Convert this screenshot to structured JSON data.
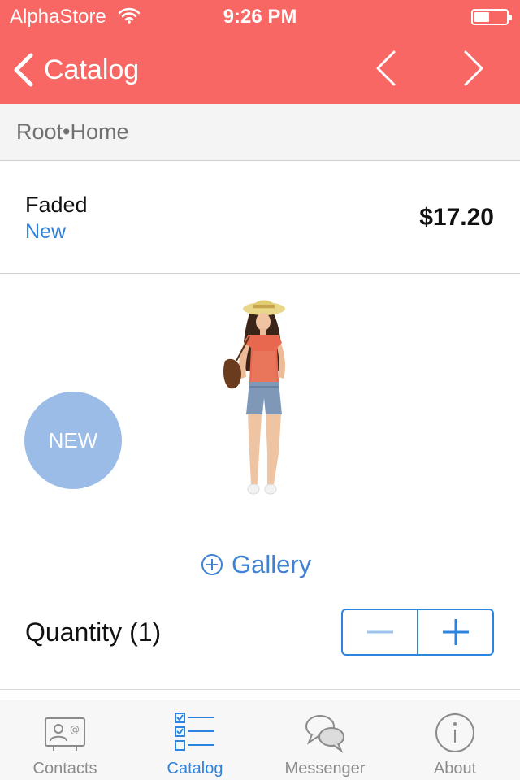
{
  "status_bar": {
    "carrier": "AlphaStore",
    "time": "9:26 PM",
    "icons": [
      "wifi-icon",
      "battery-icon"
    ]
  },
  "nav": {
    "back_label": "Catalog",
    "icons": [
      "chevron-left-icon",
      "chevron-right-icon"
    ]
  },
  "breadcrumb": {
    "text": "Root•Home"
  },
  "product": {
    "name": "Faded",
    "status": "New",
    "price": "$17.20",
    "badge": "NEW"
  },
  "gallery": {
    "label": "Gallery",
    "icon": "plus-circle-icon"
  },
  "quantity": {
    "label": "Quantity (1)",
    "value": 1
  },
  "tabs": [
    {
      "label": "Contacts",
      "icon": "contacts-card-icon",
      "active": false
    },
    {
      "label": "Catalog",
      "icon": "checklist-icon",
      "active": true
    },
    {
      "label": "Messenger",
      "icon": "chat-bubbles-icon",
      "active": false
    },
    {
      "label": "About",
      "icon": "info-icon",
      "active": false
    }
  ],
  "colors": {
    "header_bg": "#f86763",
    "accent": "#2d83e0",
    "badge": "#9bbce7"
  }
}
